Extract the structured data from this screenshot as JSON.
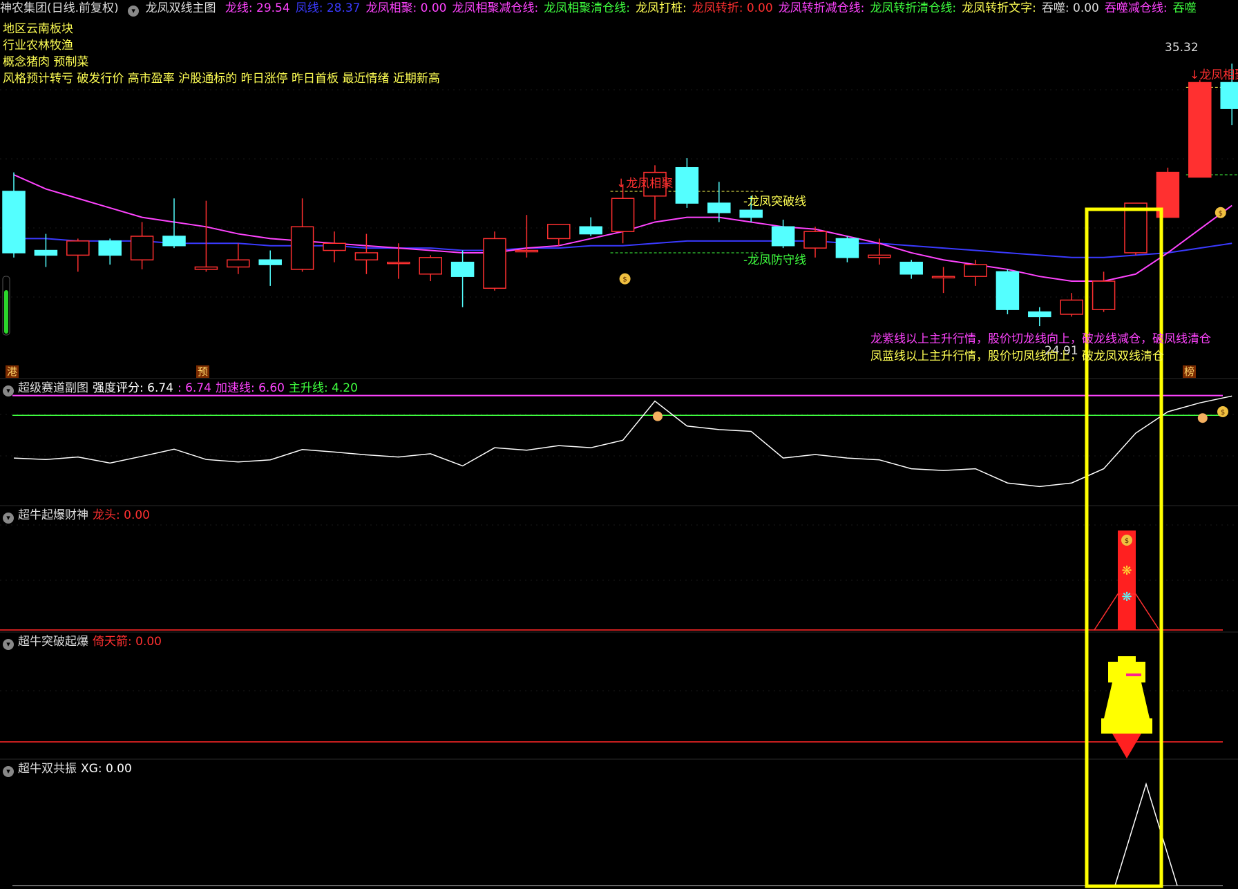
{
  "header": {
    "stock": "神农集团(日线.前复权)",
    "indicator": "龙凤双线主图",
    "items": [
      {
        "label": "龙线: 29.54",
        "color": "#ff44ff"
      },
      {
        "label": "凤线: 28.37",
        "color": "#3a3aff"
      },
      {
        "label": "龙凤相聚: 0.00",
        "color": "#ff44ff"
      },
      {
        "label": "龙凤相聚减仓线:",
        "color": "#ff44ff"
      },
      {
        "label": "龙凤相聚清仓线:",
        "color": "#3fff3f"
      },
      {
        "label": "龙凤打桩:",
        "color": "#ffff54"
      },
      {
        "label": "龙凤转折: 0.00",
        "color": "#ff3030"
      },
      {
        "label": "龙凤转折减仓线:",
        "color": "#ff44ff"
      },
      {
        "label": "龙凤转折清仓线:",
        "color": "#3fff3f"
      },
      {
        "label": "龙凤转折文字:",
        "color": "#ffff54"
      },
      {
        "label": "吞噬: 0.00",
        "color": "#dddddd"
      },
      {
        "label": "吞噬减仓线:",
        "color": "#ff44ff"
      },
      {
        "label": "吞噬",
        "color": "#3fff3f"
      }
    ]
  },
  "info_lines": [
    "地区云南板块",
    "行业农林牧渔",
    "概念猪肉 预制菜",
    "风格预计转亏 破发行价 高市盈率 沪股通标的 昨日涨停 昨日首板 最近情绪 近期新高"
  ],
  "main_labels": {
    "price_high": "35.32",
    "price_low": "24.91",
    "breakout_line": "-龙凤突破线",
    "defense_line": "-龙凤防守线",
    "gather": "↓龙凤相聚",
    "gather2": "↓龙凤相聚",
    "note1": "龙紫线以上主升行情，股价切龙线向上，破龙线减仓，破凤线清仓",
    "note2": "凤蓝线以上主升行情，股价切凤线向上，破龙凤双线清仓",
    "tag_gang": "港",
    "tag_yu": "预",
    "tag_bang": "榜"
  },
  "panels": [
    {
      "title": "超级赛道副图",
      "items": [
        {
          "label": "强度评分: 6.74",
          "color": "#ffffff"
        },
        {
          "label": ": 6.74",
          "color": "#ff44ff"
        },
        {
          "label": "加速线: 6.60",
          "color": "#ff44ff"
        },
        {
          "label": "主升线: 4.20",
          "color": "#3fff3f"
        }
      ]
    },
    {
      "title": "超牛起爆财神",
      "items": [
        {
          "label": "龙头: 0.00",
          "color": "#ff3030"
        }
      ]
    },
    {
      "title": "超牛突破起爆",
      "items": [
        {
          "label": "倚天箭: 0.00",
          "color": "#ff3030"
        }
      ]
    },
    {
      "title": "超牛双共振",
      "items": [
        {
          "label": "XG: 0.00",
          "color": "#ffffff"
        }
      ]
    }
  ],
  "colors": {
    "up": "#ff3030",
    "down": "#54ffff",
    "dragon": "#ff44ff",
    "phoenix": "#3a3aff",
    "highlight": "#ffff00",
    "strength": "#ffffff",
    "accel": "#ff44ff",
    "main": "#3fff3f"
  },
  "chart_data": {
    "type": "candlestick",
    "ylim": [
      23.5,
      36.5
    ],
    "candles": [
      {
        "o": 30.6,
        "h": 31.4,
        "l": 27.8,
        "c": 28.0
      },
      {
        "o": 28.1,
        "h": 28.8,
        "l": 27.4,
        "c": 27.9
      },
      {
        "o": 27.9,
        "h": 28.6,
        "l": 27.2,
        "c": 28.5
      },
      {
        "o": 28.5,
        "h": 28.6,
        "l": 27.5,
        "c": 27.9
      },
      {
        "o": 27.7,
        "h": 29.3,
        "l": 27.3,
        "c": 28.7
      },
      {
        "o": 28.7,
        "h": 30.3,
        "l": 28.2,
        "c": 28.3
      },
      {
        "o": 27.3,
        "h": 30.2,
        "l": 27.2,
        "c": 27.4
      },
      {
        "o": 27.4,
        "h": 28.4,
        "l": 27.1,
        "c": 27.7
      },
      {
        "o": 27.7,
        "h": 28.1,
        "l": 26.6,
        "c": 27.5
      },
      {
        "o": 27.3,
        "h": 30.3,
        "l": 27.2,
        "c": 29.1
      },
      {
        "o": 28.1,
        "h": 28.9,
        "l": 27.6,
        "c": 28.4
      },
      {
        "o": 27.7,
        "h": 28.8,
        "l": 27.1,
        "c": 28.0
      },
      {
        "o": 27.6,
        "h": 28.4,
        "l": 26.9,
        "c": 27.6
      },
      {
        "o": 27.1,
        "h": 27.9,
        "l": 26.8,
        "c": 27.8
      },
      {
        "o": 27.6,
        "h": 28.1,
        "l": 25.7,
        "c": 27.0
      },
      {
        "o": 26.5,
        "h": 28.9,
        "l": 26.4,
        "c": 28.6
      },
      {
        "o": 28.1,
        "h": 29.6,
        "l": 27.8,
        "c": 28.1
      },
      {
        "o": 28.6,
        "h": 29.2,
        "l": 28.3,
        "c": 29.2
      },
      {
        "o": 29.1,
        "h": 29.5,
        "l": 28.7,
        "c": 28.8
      },
      {
        "o": 28.9,
        "h": 30.9,
        "l": 28.4,
        "c": 30.3
      },
      {
        "o": 30.4,
        "h": 31.7,
        "l": 29.4,
        "c": 31.4
      },
      {
        "o": 31.6,
        "h": 32.0,
        "l": 29.9,
        "c": 30.1
      },
      {
        "o": 30.1,
        "h": 31.0,
        "l": 29.3,
        "c": 29.7
      },
      {
        "o": 29.8,
        "h": 30.4,
        "l": 29.3,
        "c": 29.5
      },
      {
        "o": 29.1,
        "h": 29.4,
        "l": 28.2,
        "c": 28.3
      },
      {
        "o": 28.2,
        "h": 29.1,
        "l": 27.8,
        "c": 28.9
      },
      {
        "o": 28.6,
        "h": 28.7,
        "l": 27.6,
        "c": 27.8
      },
      {
        "o": 27.8,
        "h": 28.6,
        "l": 27.5,
        "c": 27.9
      },
      {
        "o": 27.6,
        "h": 27.7,
        "l": 26.9,
        "c": 27.1
      },
      {
        "o": 27.0,
        "h": 27.4,
        "l": 26.3,
        "c": 27.0
      },
      {
        "o": 27.0,
        "h": 27.7,
        "l": 26.6,
        "c": 27.5
      },
      {
        "o": 27.2,
        "h": 27.3,
        "l": 25.4,
        "c": 25.6
      },
      {
        "o": 25.5,
        "h": 25.7,
        "l": 24.9,
        "c": 25.3
      },
      {
        "o": 25.4,
        "h": 26.3,
        "l": 25.3,
        "c": 26.0
      },
      {
        "o": 25.6,
        "h": 27.2,
        "l": 25.5,
        "c": 26.8
      },
      {
        "o": 28.0,
        "h": 30.1,
        "l": 27.9,
        "c": 30.1
      },
      {
        "o": 29.5,
        "h": 31.6,
        "l": 29.5,
        "c": 31.4
      },
      {
        "o": 31.2,
        "h": 35.3,
        "l": 31.2,
        "c": 35.2
      },
      {
        "o": 35.2,
        "h": 36.0,
        "l": 33.4,
        "c": 34.1
      }
    ],
    "dragon_line": [
      31.3,
      30.7,
      30.3,
      29.9,
      29.5,
      29.3,
      29.1,
      28.8,
      28.6,
      28.5,
      28.4,
      28.3,
      28.2,
      28.1,
      28.0,
      28.0,
      28.2,
      28.3,
      28.6,
      28.9,
      29.3,
      29.5,
      29.5,
      29.3,
      29.1,
      29.0,
      28.7,
      28.4,
      28.0,
      27.7,
      27.5,
      27.3,
      27.0,
      26.8,
      26.8,
      27.1,
      28.0,
      29.0,
      30.0
    ],
    "phoenix_line": [
      28.6,
      28.6,
      28.5,
      28.5,
      28.5,
      28.4,
      28.4,
      28.4,
      28.3,
      28.3,
      28.3,
      28.2,
      28.2,
      28.2,
      28.1,
      28.1,
      28.2,
      28.2,
      28.3,
      28.3,
      28.4,
      28.5,
      28.5,
      28.5,
      28.5,
      28.5,
      28.4,
      28.4,
      28.3,
      28.2,
      28.1,
      28.0,
      27.9,
      27.8,
      27.8,
      27.9,
      28.0,
      28.2,
      28.4
    ],
    "breakout_level": 30.6,
    "defense_level": 28.0,
    "strength": [
      5.0,
      4.96,
      5.03,
      4.86,
      5.05,
      5.25,
      4.96,
      4.89,
      4.95,
      5.24,
      5.17,
      5.09,
      5.03,
      5.12,
      4.78,
      5.29,
      5.22,
      5.35,
      5.29,
      5.5,
      6.6,
      5.9,
      5.8,
      5.75,
      5.0,
      5.1,
      5.0,
      4.95,
      4.7,
      4.65,
      4.7,
      4.3,
      4.2,
      4.3,
      4.7,
      5.7,
      6.3,
      6.55,
      6.74
    ],
    "strength_ylim": [
      3.8,
      7.0
    ],
    "accel_line": 6.6,
    "main_rise_line": 6.2,
    "xg_signal_index": 35
  }
}
